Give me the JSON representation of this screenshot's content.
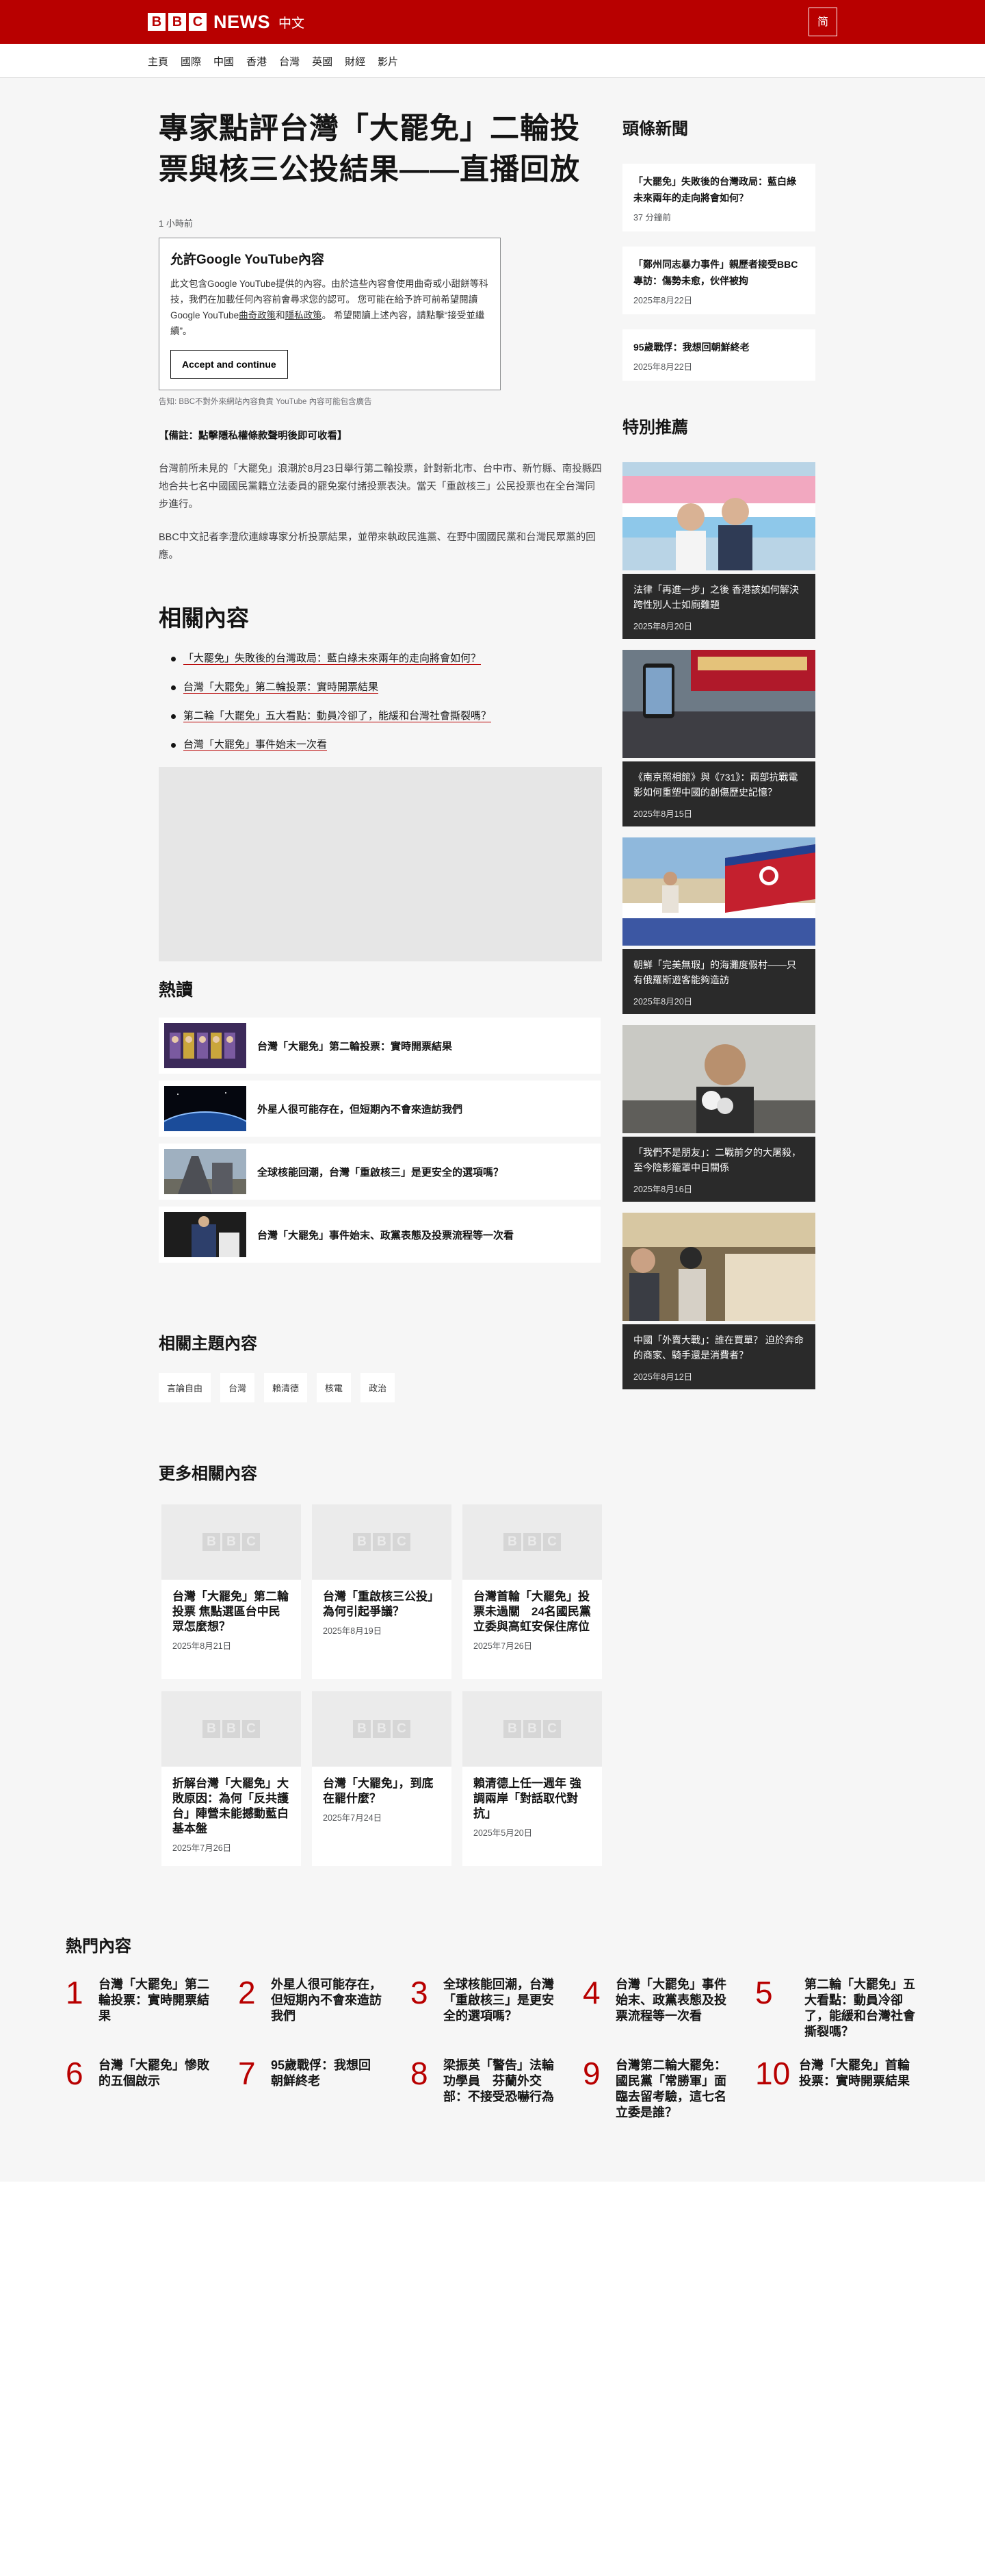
{
  "header": {
    "logo_letters": [
      "B",
      "B",
      "C"
    ],
    "brand": "NEWS",
    "lang": "中文",
    "script_toggle": "简"
  },
  "nav": [
    "主頁",
    "國際",
    "中國",
    "香港",
    "台灣",
    "英國",
    "財經",
    "影片"
  ],
  "article": {
    "headline": "專家點評台灣「大罷免」二輪投票與核三公投結果——直播回放",
    "timestamp": "1 小時前",
    "youtube": {
      "title": "允許Google YouTube內容",
      "text_1": "此文包含Google YouTube提供的內容。由於這些內容會使用曲奇或小甜餅等科技，我們在加載任何內容前會尋求您的認可。 您可能在給予許可前希望閱讀Google YouTube",
      "link_1": "曲奇政策",
      "and": "和",
      "link_2": "隱私政策",
      "text_2": "。 希望閱讀上述內容，請點擊“接受並繼續”。",
      "accept": "Accept and continue",
      "warning": "告知: BBC不對外來網站內容負責 YouTube 內容可能包含廣告"
    },
    "note": "【備註：點擊隱私權條款聲明後即可收看】",
    "para_1": "台灣前所未見的「大罷免」浪潮於8月23日舉行第二輪投票，針對新北市、台中市、新竹縣、南投縣四地合共七名中國國民黨籍立法委員的罷免案付諸投票表決。當天「重啟核三」公民投票也在全台灣同步進行。",
    "para_2": "BBC中文記者李澄欣連線專家分析投票結果，並帶來執政民進黨、在野中國國民黨和台灣民眾黨的回應。"
  },
  "related": {
    "title": "相關內容",
    "items": [
      "「大罷免」失敗後的台灣政局：藍白綠未來兩年的走向將會如何？",
      "台灣「大罷免」第二輪投票：實時開票結果",
      "第二輪「大罷免」五大看點：動員冷卻了，能緩和台灣社會撕裂嗎？",
      "台灣「大罷免」事件始末一次看"
    ]
  },
  "hot": {
    "title": "熱讀",
    "items": [
      "台灣「大罷免」第二輪投票：實時開票結果",
      "外星人很可能存在，但短期內不會來造訪我們",
      "全球核能回潮，台灣「重啟核三」是更安全的選項嗎？",
      "台灣「大罷免」事件始末、政黨表態及投票流程等一次看"
    ]
  },
  "topics": {
    "title": "相關主題內容",
    "items": [
      "言論自由",
      "台灣",
      "賴清德",
      "核電",
      "政治"
    ]
  },
  "more": {
    "title": "更多相關內容",
    "cards": [
      {
        "title": "台灣「大罷免」第二輪投票 焦點選區台中民眾怎麼想？",
        "date": "2025年8月21日"
      },
      {
        "title": "台灣「重啟核三公投」為何引起爭議？",
        "date": "2025年8月19日"
      },
      {
        "title": "台灣首輪「大罷免」投票未過關　24名國民黨立委與高虹安保住席位",
        "date": "2025年7月26日"
      },
      {
        "title": "折解台灣「大罷免」大敗原因：為何「反共護台」陣營未能撼動藍白基本盤",
        "date": "2025年7月26日"
      },
      {
        "title": "台灣「大罷免」，到底在罷什麼？",
        "date": "2025年7月24日"
      },
      {
        "title": "賴清德上任一週年 強調兩岸「對話取代對抗」",
        "date": "2025年5月20日"
      }
    ]
  },
  "sidebar": {
    "top_title": "頭條新聞",
    "top_news": [
      {
        "title": "「大罷免」失敗後的台灣政局：藍白綠未來兩年的走向將會如何？",
        "date": "37 分鐘前"
      },
      {
        "title": "「鄭州同志暴力事件」親歷者接受BBC專訪：傷勢未愈，伙伴被拘",
        "date": "2025年8月22日"
      },
      {
        "title": "95歲戰俘：我想回朝鮮終老",
        "date": "2025年8月22日"
      }
    ],
    "feature_title": "特別推薦",
    "features": [
      {
        "text": "法律「再進一步」之後 香港該如何解決跨性別人士如廁難題",
        "date": "2025年8月20日"
      },
      {
        "text": "《南京照相館》與《731》：兩部抗戰電影如何重塑中國的創傷歷史記憶？",
        "date": "2025年8月15日"
      },
      {
        "text": "朝鮮「完美無瑕」的海灘度假村——只有俄羅斯遊客能夠造訪",
        "date": "2025年8月20日"
      },
      {
        "text": "「我們不是朋友」：二戰前夕的大屠殺，至今陰影籠罩中日關係",
        "date": "2025年8月16日"
      },
      {
        "text": "中國「外賣大戰」：誰在買單？ 迫於奔命的商家、騎手還是消費者？",
        "date": "2025年8月12日"
      }
    ]
  },
  "mostread": {
    "title": "熱門內容",
    "items": [
      {
        "num": "1",
        "text": "台灣「大罷免」第二輪投票：實時開票結果"
      },
      {
        "num": "2",
        "text": "外星人很可能存在，但短期內不會來造訪我們"
      },
      {
        "num": "3",
        "text": "全球核能回潮，台灣「重啟核三」是更安全的選項嗎？"
      },
      {
        "num": "4",
        "text": "台灣「大罷免」事件始末、政黨表態及投票流程等一次看"
      },
      {
        "num": "5",
        "text": "第二輪「大罷免」五大看點：動員冷卻了，能緩和台灣社會撕裂嗎？"
      },
      {
        "num": "6",
        "text": "台灣「大罷免」慘敗的五個啟示"
      },
      {
        "num": "7",
        "text": "95歲戰俘：我想回朝鮮終老"
      },
      {
        "num": "8",
        "text": "梁振英「警告」法輪功學員　芬蘭外交部：不接受恐嚇行為"
      },
      {
        "num": "9",
        "text": "台灣第二輪大罷免：國民黨「常勝軍」面臨去留考驗，這七名立委是誰？"
      },
      {
        "num": "10",
        "text": "台灣「大罷免」首輪投票：實時開票結果"
      }
    ]
  }
}
